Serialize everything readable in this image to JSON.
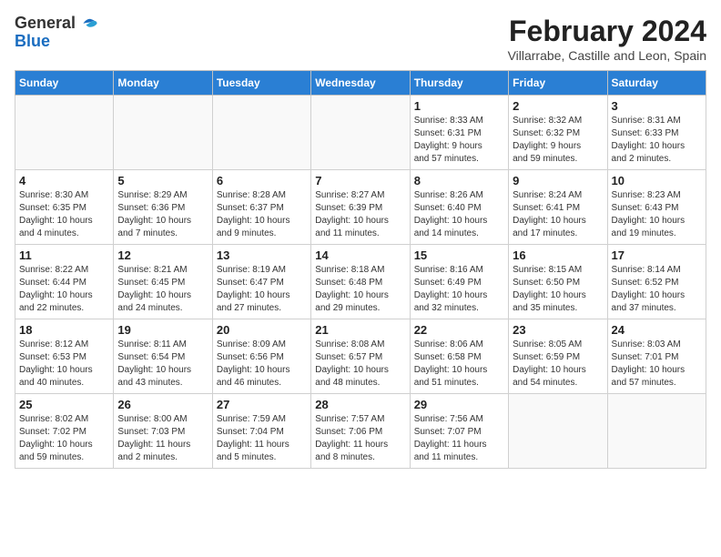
{
  "header": {
    "logo_general": "General",
    "logo_blue": "Blue",
    "title": "February 2024",
    "location": "Villarrabe, Castille and Leon, Spain"
  },
  "weekdays": [
    "Sunday",
    "Monday",
    "Tuesday",
    "Wednesday",
    "Thursday",
    "Friday",
    "Saturday"
  ],
  "weeks": [
    [
      {
        "day": "",
        "info": ""
      },
      {
        "day": "",
        "info": ""
      },
      {
        "day": "",
        "info": ""
      },
      {
        "day": "",
        "info": ""
      },
      {
        "day": "1",
        "info": "Sunrise: 8:33 AM\nSunset: 6:31 PM\nDaylight: 9 hours\nand 57 minutes."
      },
      {
        "day": "2",
        "info": "Sunrise: 8:32 AM\nSunset: 6:32 PM\nDaylight: 9 hours\nand 59 minutes."
      },
      {
        "day": "3",
        "info": "Sunrise: 8:31 AM\nSunset: 6:33 PM\nDaylight: 10 hours\nand 2 minutes."
      }
    ],
    [
      {
        "day": "4",
        "info": "Sunrise: 8:30 AM\nSunset: 6:35 PM\nDaylight: 10 hours\nand 4 minutes."
      },
      {
        "day": "5",
        "info": "Sunrise: 8:29 AM\nSunset: 6:36 PM\nDaylight: 10 hours\nand 7 minutes."
      },
      {
        "day": "6",
        "info": "Sunrise: 8:28 AM\nSunset: 6:37 PM\nDaylight: 10 hours\nand 9 minutes."
      },
      {
        "day": "7",
        "info": "Sunrise: 8:27 AM\nSunset: 6:39 PM\nDaylight: 10 hours\nand 11 minutes."
      },
      {
        "day": "8",
        "info": "Sunrise: 8:26 AM\nSunset: 6:40 PM\nDaylight: 10 hours\nand 14 minutes."
      },
      {
        "day": "9",
        "info": "Sunrise: 8:24 AM\nSunset: 6:41 PM\nDaylight: 10 hours\nand 17 minutes."
      },
      {
        "day": "10",
        "info": "Sunrise: 8:23 AM\nSunset: 6:43 PM\nDaylight: 10 hours\nand 19 minutes."
      }
    ],
    [
      {
        "day": "11",
        "info": "Sunrise: 8:22 AM\nSunset: 6:44 PM\nDaylight: 10 hours\nand 22 minutes."
      },
      {
        "day": "12",
        "info": "Sunrise: 8:21 AM\nSunset: 6:45 PM\nDaylight: 10 hours\nand 24 minutes."
      },
      {
        "day": "13",
        "info": "Sunrise: 8:19 AM\nSunset: 6:47 PM\nDaylight: 10 hours\nand 27 minutes."
      },
      {
        "day": "14",
        "info": "Sunrise: 8:18 AM\nSunset: 6:48 PM\nDaylight: 10 hours\nand 29 minutes."
      },
      {
        "day": "15",
        "info": "Sunrise: 8:16 AM\nSunset: 6:49 PM\nDaylight: 10 hours\nand 32 minutes."
      },
      {
        "day": "16",
        "info": "Sunrise: 8:15 AM\nSunset: 6:50 PM\nDaylight: 10 hours\nand 35 minutes."
      },
      {
        "day": "17",
        "info": "Sunrise: 8:14 AM\nSunset: 6:52 PM\nDaylight: 10 hours\nand 37 minutes."
      }
    ],
    [
      {
        "day": "18",
        "info": "Sunrise: 8:12 AM\nSunset: 6:53 PM\nDaylight: 10 hours\nand 40 minutes."
      },
      {
        "day": "19",
        "info": "Sunrise: 8:11 AM\nSunset: 6:54 PM\nDaylight: 10 hours\nand 43 minutes."
      },
      {
        "day": "20",
        "info": "Sunrise: 8:09 AM\nSunset: 6:56 PM\nDaylight: 10 hours\nand 46 minutes."
      },
      {
        "day": "21",
        "info": "Sunrise: 8:08 AM\nSunset: 6:57 PM\nDaylight: 10 hours\nand 48 minutes."
      },
      {
        "day": "22",
        "info": "Sunrise: 8:06 AM\nSunset: 6:58 PM\nDaylight: 10 hours\nand 51 minutes."
      },
      {
        "day": "23",
        "info": "Sunrise: 8:05 AM\nSunset: 6:59 PM\nDaylight: 10 hours\nand 54 minutes."
      },
      {
        "day": "24",
        "info": "Sunrise: 8:03 AM\nSunset: 7:01 PM\nDaylight: 10 hours\nand 57 minutes."
      }
    ],
    [
      {
        "day": "25",
        "info": "Sunrise: 8:02 AM\nSunset: 7:02 PM\nDaylight: 10 hours\nand 59 minutes."
      },
      {
        "day": "26",
        "info": "Sunrise: 8:00 AM\nSunset: 7:03 PM\nDaylight: 11 hours\nand 2 minutes."
      },
      {
        "day": "27",
        "info": "Sunrise: 7:59 AM\nSunset: 7:04 PM\nDaylight: 11 hours\nand 5 minutes."
      },
      {
        "day": "28",
        "info": "Sunrise: 7:57 AM\nSunset: 7:06 PM\nDaylight: 11 hours\nand 8 minutes."
      },
      {
        "day": "29",
        "info": "Sunrise: 7:56 AM\nSunset: 7:07 PM\nDaylight: 11 hours\nand 11 minutes."
      },
      {
        "day": "",
        "info": ""
      },
      {
        "day": "",
        "info": ""
      }
    ]
  ]
}
